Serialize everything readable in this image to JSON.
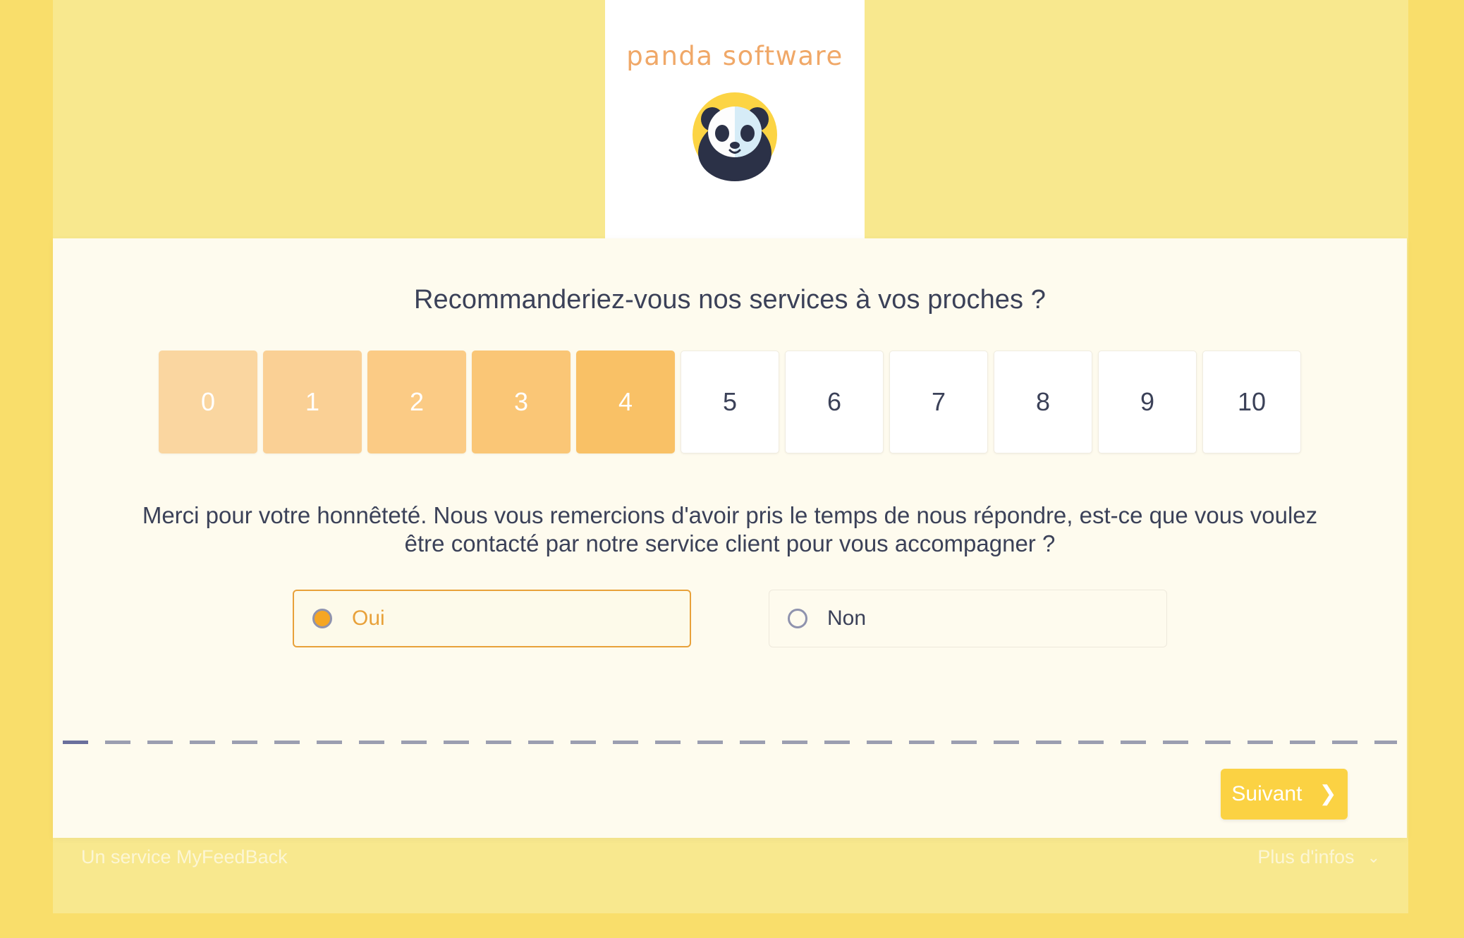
{
  "brand": {
    "wordmark": "panda software",
    "logo_icon": "panda-logo-icon",
    "accent_color": "#f0a868",
    "logo_circle_color": "#fcd444",
    "logo_dark_color": "#2b3147"
  },
  "survey": {
    "question": "Recommanderiez-vous nos services à vos proches ?",
    "scale": {
      "values": [
        "0",
        "1",
        "2",
        "3",
        "4",
        "5",
        "6",
        "7",
        "8",
        "9",
        "10"
      ],
      "highlighted_up_to": 4,
      "highlight_colors": [
        "#fad6a0",
        "#fad095",
        "#fbcb85",
        "#fac676",
        "#f9c166"
      ],
      "neutral_color": "#ffffff",
      "neutral_text_color": "#3b4158"
    },
    "followup_question": "Merci pour votre honnêteté. Nous vous remercions d'avoir pris le temps de nous répondre, est-ce que vous voulez être contacté par notre service client pour vous accompagner ?",
    "options": [
      {
        "label": "Oui",
        "selected": true
      },
      {
        "label": "Non",
        "selected": false
      }
    ],
    "selected_option_color": "#e8a13a",
    "radio_fill_color": "#f5a623"
  },
  "progress": {
    "completed_segments": 1,
    "track_color": "#9b9eb0",
    "progress_color": "#6a6f9c"
  },
  "actions": {
    "next_label": "Suivant",
    "next_chevron": "❯",
    "next_color": "#fbd243"
  },
  "footer": {
    "left_text": "Un service MyFeedBack",
    "right_text": "Plus d'infos",
    "right_chevron": "⌄"
  },
  "theme": {
    "outer_band": "#f9de6b",
    "page_bg": "#f8e88e",
    "card_bg": "#fefbee",
    "text_dark": "#3b4158"
  }
}
